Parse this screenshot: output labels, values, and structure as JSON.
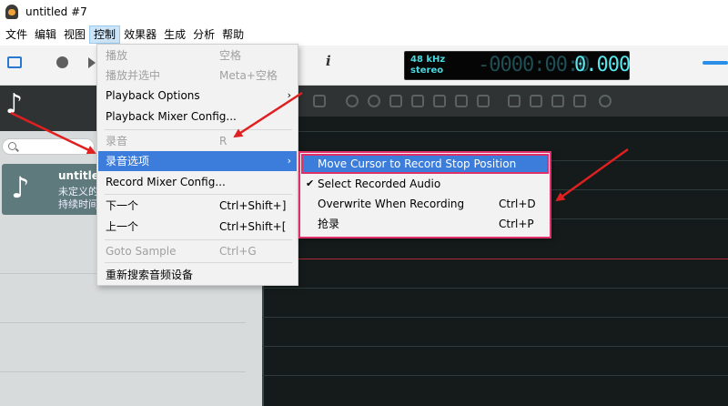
{
  "window": {
    "title": "untitled #7"
  },
  "menubar": [
    {
      "label": "文件"
    },
    {
      "label": "编辑"
    },
    {
      "label": "视图"
    },
    {
      "label": "控制"
    },
    {
      "label": "效果器"
    },
    {
      "label": "生成"
    },
    {
      "label": "分析"
    },
    {
      "label": "帮助"
    }
  ],
  "time_display": {
    "rate": "48 kHz",
    "channels": "stereo",
    "time_dim": "-0000:00:0",
    "time_lit": "0.000"
  },
  "info_icon": "i",
  "sample": {
    "name": "untitled",
    "line2": "未定义的",
    "line3": "持续时间"
  },
  "control_menu": {
    "items": [
      {
        "label": "播放",
        "shortcut": "空格",
        "disabled": true
      },
      {
        "label": "播放并选中",
        "shortcut": "Meta+空格",
        "disabled": true
      },
      {
        "label": "Playback Options",
        "shortcut": "",
        "submenu": true
      },
      {
        "label": "Playback Mixer Config...",
        "shortcut": ""
      },
      {
        "label": "录音",
        "shortcut": "R",
        "disabled": true
      },
      {
        "label": "录音选项",
        "shortcut": "",
        "submenu": true,
        "highlight": true
      },
      {
        "label": "Record Mixer Config...",
        "shortcut": ""
      },
      {
        "label": "下一个",
        "shortcut": "Ctrl+Shift+]"
      },
      {
        "label": "上一个",
        "shortcut": "Ctrl+Shift+["
      },
      {
        "label": "Goto Sample",
        "shortcut": "Ctrl+G",
        "disabled": true
      },
      {
        "label": "重新搜索音频设备",
        "shortcut": ""
      }
    ]
  },
  "record_options_submenu": {
    "items": [
      {
        "label": "Move Cursor to Record Stop Position",
        "shortcut": "",
        "highlight": true
      },
      {
        "label": "Select Recorded Audio",
        "shortcut": "",
        "checked": true
      },
      {
        "label": "Overwrite When Recording",
        "shortcut": "Ctrl+D"
      },
      {
        "label": "抢录",
        "shortcut": "Ctrl+P"
      }
    ]
  },
  "colors": {
    "menu_highlight": "#3c7ddb",
    "annotation_red": "#e02020",
    "submenu_border": "#e0306a",
    "display_cyan": "#59e7ef"
  }
}
